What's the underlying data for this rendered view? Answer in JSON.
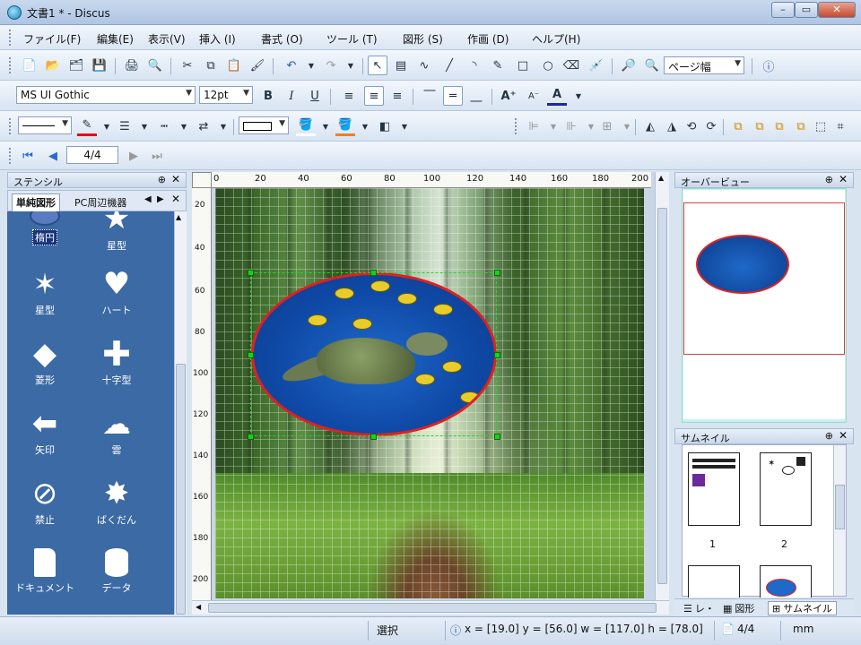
{
  "window": {
    "title": "文書1 * - Discus",
    "min_label": "–",
    "max_label": "▭",
    "close_label": "✕"
  },
  "menu": [
    "ファイル(F)",
    "編集(E)",
    "表示(V)",
    "挿入 (I)",
    "書式 (O)",
    "ツール (T)",
    "図形 (S)",
    "作画 (D)",
    "ヘルプ(H)"
  ],
  "toolbar": {
    "zoom_combo": "ページ幅",
    "font_name": "MS UI Gothic",
    "font_size": "12pt",
    "bold": "B",
    "italic": "I",
    "underline": "U",
    "page_field": "4/4"
  },
  "stencil": {
    "title": "ステンシル",
    "tabs": [
      "単純図形",
      "PC周辺機器"
    ],
    "shapes": [
      "楕円",
      "星型",
      "星型",
      "ハート",
      "菱形",
      "十字型",
      "矢印",
      "雲",
      "禁止",
      "ばくだん",
      "ドキュメント",
      "データ"
    ]
  },
  "ruler": {
    "h": [
      "0",
      "20",
      "40",
      "60",
      "80",
      "100",
      "120",
      "140",
      "160",
      "180",
      "200"
    ],
    "v": [
      "20",
      "40",
      "60",
      "80",
      "100",
      "120",
      "140",
      "160",
      "180",
      "200"
    ]
  },
  "overview": {
    "title": "オーバービュー"
  },
  "thumbnails": {
    "title": "サムネイル",
    "pages": [
      "1",
      "2"
    ]
  },
  "right_tabs": [
    "レ・",
    "図形",
    "サムネイル"
  ],
  "status": {
    "mode": "選択",
    "coords": "x = [19.0] y = [56.0] w = [117.0] h = [78.0]",
    "page": "4/4",
    "unit": "mm"
  },
  "colors": {
    "accent": "#3b6aa4",
    "selection": "#19d119",
    "ellipse_border": "#e02020"
  }
}
